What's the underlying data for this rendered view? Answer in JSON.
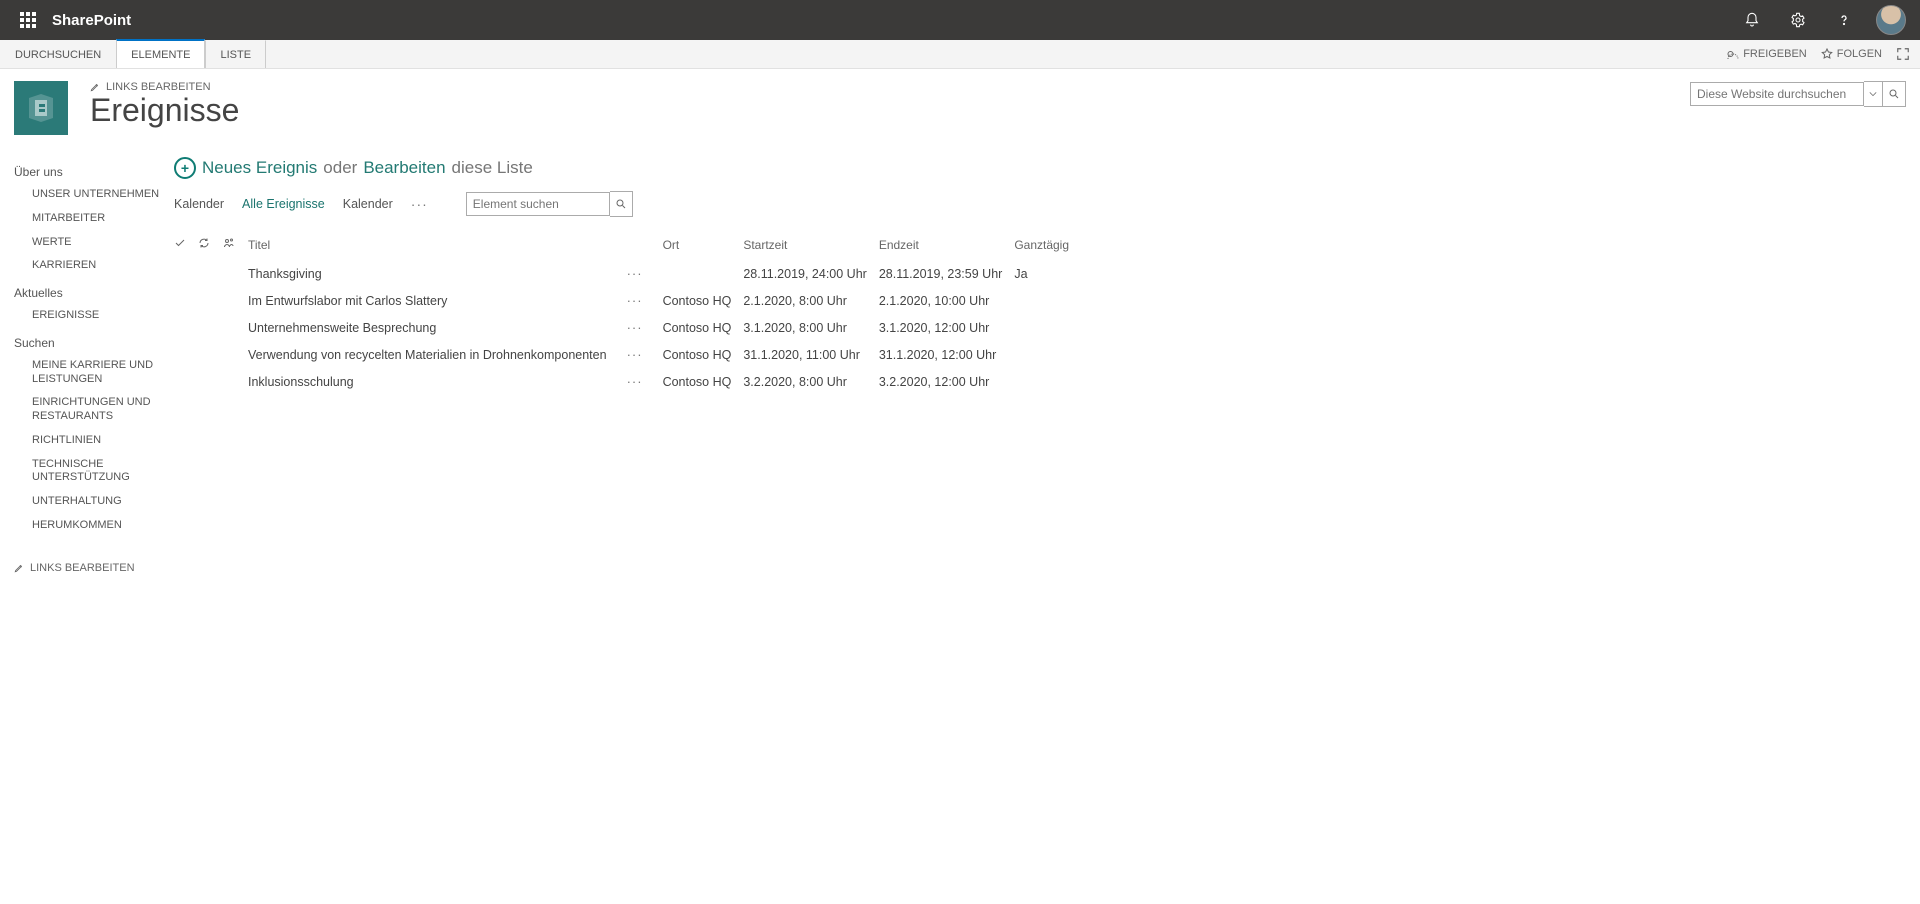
{
  "suite": {
    "brand": "SharePoint"
  },
  "ribbon": {
    "tabs": [
      "DURCHSUCHEN",
      "ELEMENTE",
      "LISTE"
    ],
    "activeIndex": 1,
    "share": "FREIGEBEN",
    "follow": "FOLGEN"
  },
  "header": {
    "editLinks": "LINKS BEARBEITEN",
    "pageTitle": "Ereignisse",
    "siteSearchPlaceholder": "Diese Website durchsuchen"
  },
  "leftnav": {
    "groups": [
      {
        "title": "Über uns",
        "items": [
          "UNSER UNTERNEHMEN",
          "MITARBEITER",
          "WERTE",
          "KARRIEREN"
        ]
      },
      {
        "title": "Aktuelles",
        "items": [
          "EREIGNISSE"
        ]
      },
      {
        "title": "Suchen",
        "items": [
          "MEINE KARRIERE UND LEISTUNGEN",
          "EINRICHTUNGEN UND RESTAURANTS",
          "RICHTLINIEN",
          "TECHNISCHE UNTERSTÜTZUNG",
          "UNTERHALTUNG",
          "HERUMKOMMEN"
        ]
      }
    ],
    "editLinks": "LINKS BEARBEITEN"
  },
  "commands": {
    "newEvent": "Neues Ereignis",
    "or": "oder",
    "edit": "Bearbeiten",
    "suffix": "diese Liste"
  },
  "views": {
    "items": [
      "Kalender",
      "Alle Ereignisse",
      "Kalender"
    ],
    "activeIndex": 1,
    "itemSearchPlaceholder": "Element suchen"
  },
  "table": {
    "headers": {
      "title": "Titel",
      "location": "Ort",
      "start": "Startzeit",
      "end": "Endzeit",
      "allday": "Ganztägig"
    },
    "rows": [
      {
        "title": "Thanksgiving",
        "location": "",
        "start": "28.11.2019, 24:00 Uhr",
        "end": "28.11.2019, 23:59 Uhr",
        "allday": "Ja"
      },
      {
        "title": "Im Entwurfslabor mit Carlos Slattery",
        "location": "Contoso HQ",
        "start": "2.1.2020, 8:00 Uhr",
        "end": "2.1.2020, 10:00 Uhr",
        "allday": ""
      },
      {
        "title": "Unternehmensweite Besprechung",
        "location": "Contoso HQ",
        "start": "3.1.2020, 8:00 Uhr",
        "end": "3.1.2020, 12:00 Uhr",
        "allday": ""
      },
      {
        "title": "Verwendung von recycelten Materialien in Drohnenkomponenten",
        "location": "Contoso HQ",
        "start": "31.1.2020, 11:00 Uhr",
        "end": "31.1.2020, 12:00 Uhr",
        "allday": ""
      },
      {
        "title": "Inklusionsschulung",
        "location": "Contoso HQ",
        "start": "3.2.2020, 8:00 Uhr",
        "end": "3.2.2020, 12:00 Uhr",
        "allday": ""
      }
    ]
  }
}
